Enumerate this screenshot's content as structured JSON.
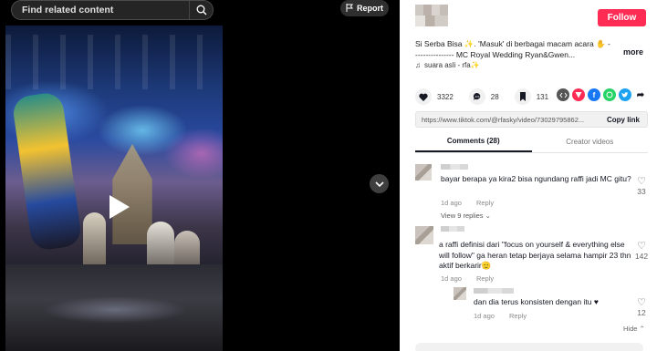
{
  "search": {
    "placeholder": "Find related content"
  },
  "report": {
    "label": "Report"
  },
  "video": {
    "state": "paused"
  },
  "post": {
    "follow_label": "Follow",
    "caption": "Si Serba Bisa ✨. 'Masuk' di berbagai macam acara ✋ ---------------- MC Royal Wedding Ryan&Gwen...",
    "more_label": "more",
    "music": "suara asli - rfa✨"
  },
  "stats": {
    "likes": "3322",
    "comments": "28",
    "saves": "131"
  },
  "share": {
    "icons": [
      "embed-icon",
      "send-icon",
      "facebook-icon",
      "whatsapp-icon",
      "twitter-icon",
      "more-share-icon"
    ],
    "colors": {
      "embed": "#555555",
      "send": "#fe2c55",
      "facebook": "#1877f2",
      "whatsapp": "#25d366",
      "twitter": "#1da1f2"
    }
  },
  "link": {
    "url": "https://www.tiktok.com/@rfasky/video/73029795862...",
    "copy_label": "Copy link"
  },
  "tabs": [
    {
      "label": "Comments (28)",
      "active": true
    },
    {
      "label": "Creator videos",
      "active": false
    }
  ],
  "comments": [
    {
      "text": "bayar berapa ya kira2 bisa ngundang raffi jadi MC gitu?",
      "time": "1d ago",
      "reply_label": "Reply",
      "likes": "33",
      "view_replies": "View 9 replies ⌄"
    },
    {
      "text": "a raffi definisi dari \"focus on yourself & everything else will follow\" ga heran tetap berjaya selama hampir 23 thn aktif berkarir🫡",
      "time": "1d ago",
      "reply_label": "Reply",
      "likes": "142"
    },
    {
      "text": "dan dia terus konsisten dengan itu ♥",
      "time": "1d ago",
      "reply_label": "Reply",
      "likes": "12"
    }
  ],
  "hide_label": "Hide ⌃",
  "accent_color": "#fe2c55"
}
